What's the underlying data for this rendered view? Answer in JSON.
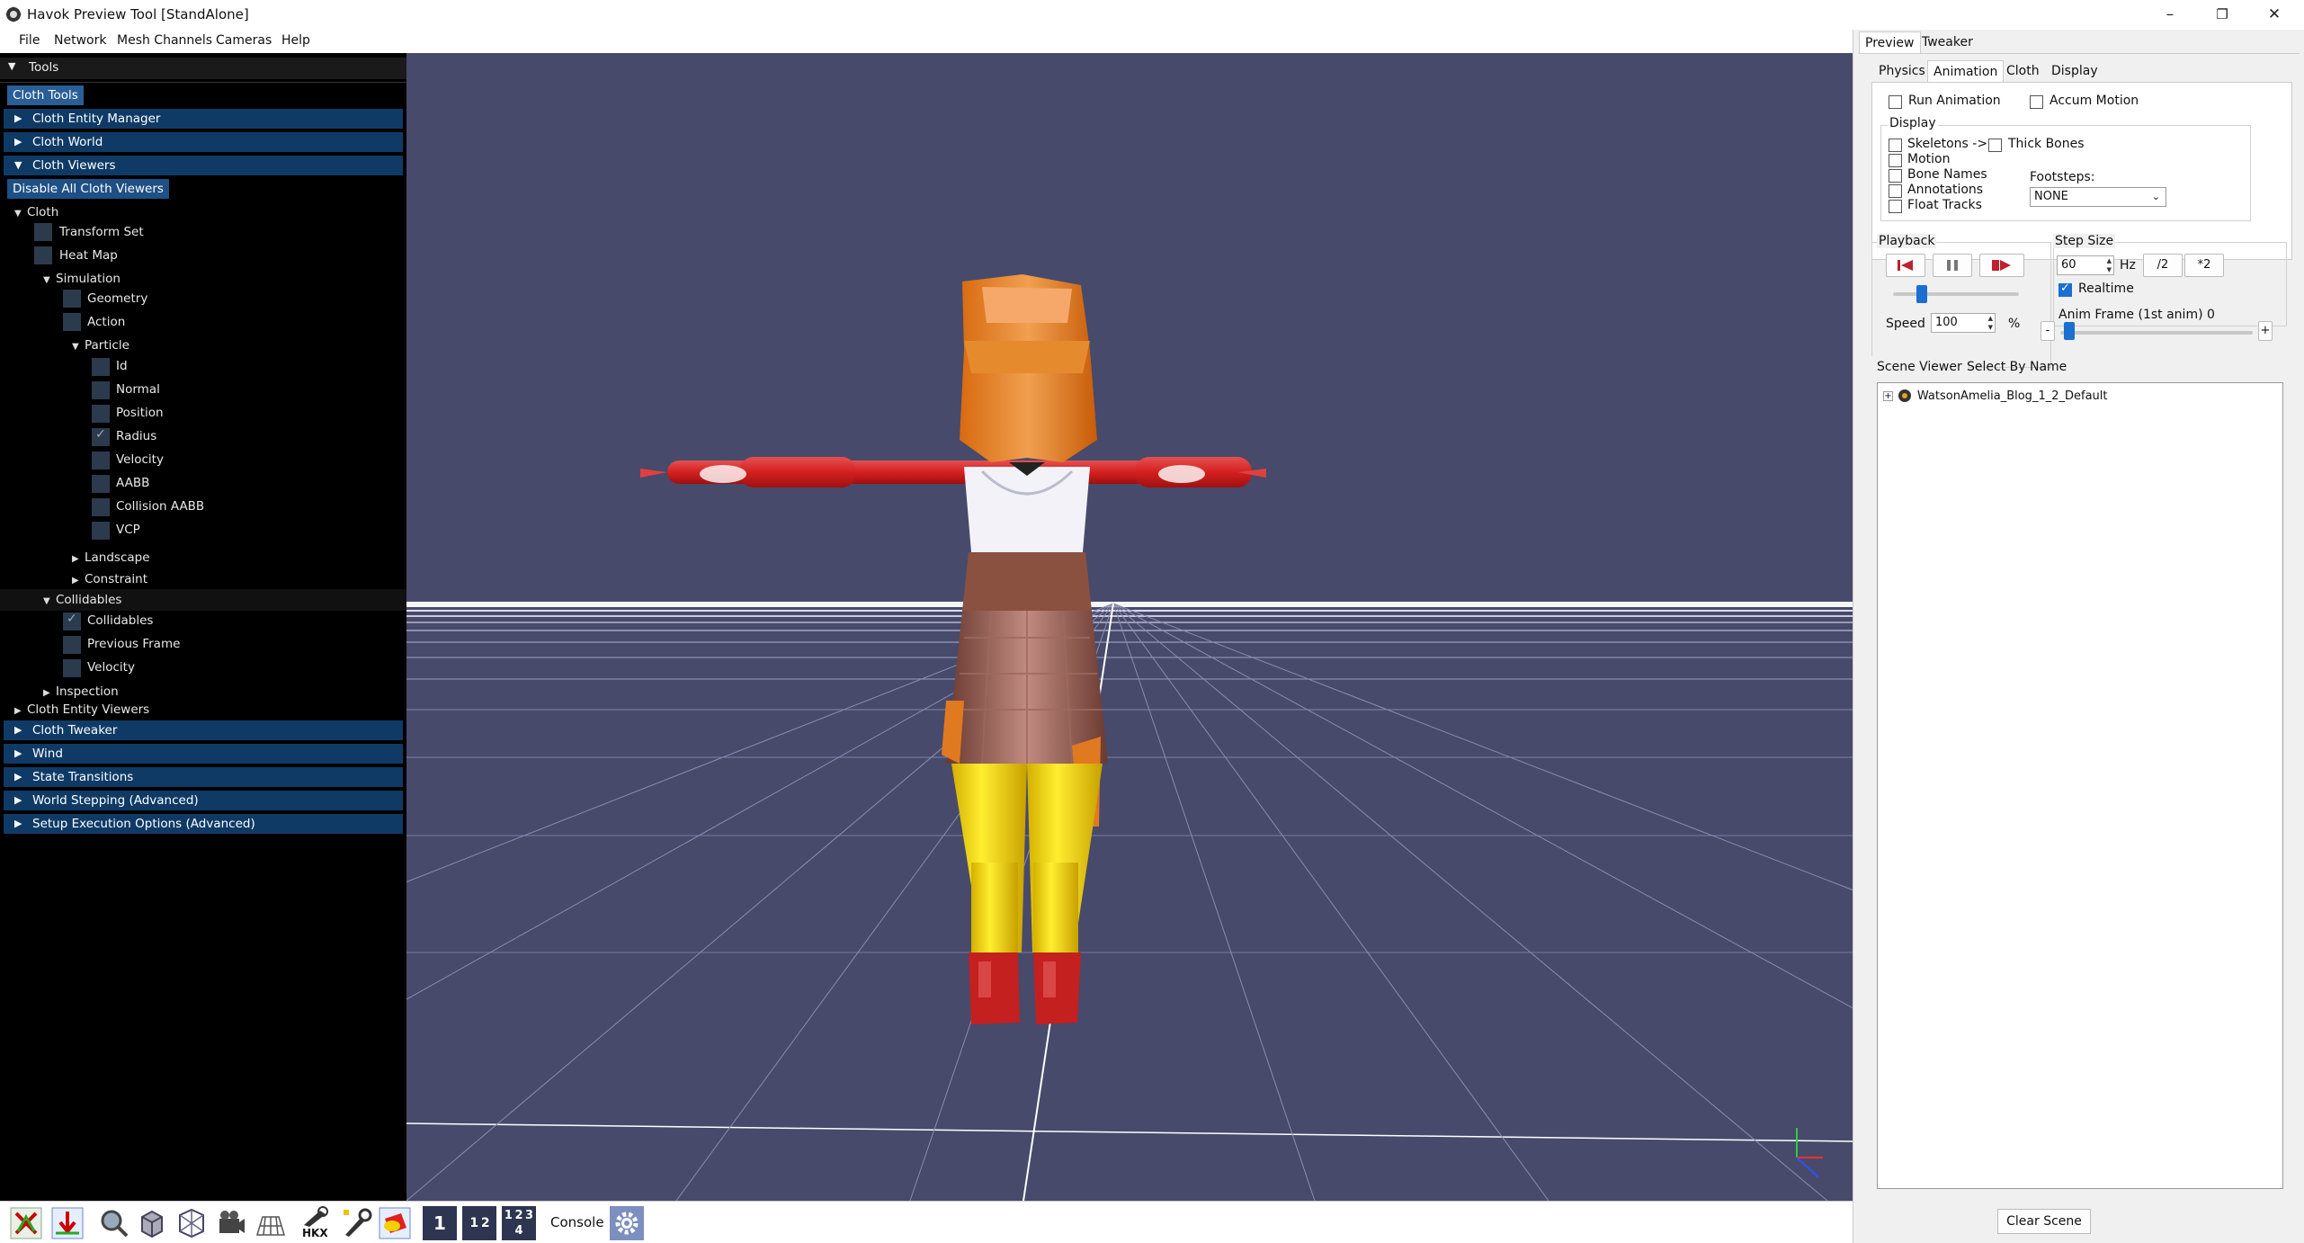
{
  "window": {
    "title": "Havok Preview Tool [StandAlone]",
    "minimize": "–",
    "maximize": "❐",
    "close": "✕"
  },
  "menu": {
    "items": [
      "File",
      "Network",
      "Mesh Channels",
      "Cameras",
      "Help"
    ]
  },
  "tools": {
    "header": "Tools",
    "cloth_tools_button": "Cloth Tools",
    "sections_top": [
      "Cloth Entity Manager",
      "Cloth World",
      "Cloth Viewers"
    ],
    "disable_all_button": "Disable All Cloth Viewers",
    "tree": {
      "cloth": "Cloth",
      "transform_set": "Transform Set",
      "heat_map": "Heat Map",
      "simulation": "Simulation",
      "geometry": "Geometry",
      "action": "Action",
      "particle": "Particle",
      "particle_items": [
        "Id",
        "Normal",
        "Position",
        "Radius",
        "Velocity",
        "AABB",
        "Collision AABB",
        "VCP"
      ],
      "particle_checked": [
        false,
        false,
        false,
        true,
        false,
        false,
        false,
        false
      ],
      "landscape": "Landscape",
      "constraint": "Constraint",
      "collidables_group": "Collidables",
      "collidables_items": [
        "Collidables",
        "Previous Frame",
        "Velocity"
      ],
      "collidables_checked": [
        true,
        false,
        false
      ],
      "inspection": "Inspection",
      "cloth_entity_viewers": "Cloth Entity Viewers"
    },
    "sections_bottom": [
      "Cloth Tweaker",
      "Wind",
      "State Transitions",
      "World Stepping (Advanced)",
      "Setup Execution Options (Advanced)"
    ]
  },
  "bottom_toolbar": {
    "icons": [
      "tool-cross-icon",
      "arrow-down-icon",
      "magnifier-icon",
      "cube-icon",
      "box-select-icon",
      "camera-icon",
      "grid-icon",
      "hkx-file-icon",
      "wrench-icon",
      "record-icon"
    ],
    "hkx_label": "HKX",
    "layout_1": "1",
    "layout_2": "1 2",
    "layout_4": "1 2 3 4",
    "console": "Console",
    "settings_icon": "gear-icon"
  },
  "right": {
    "top_tabs": [
      "Preview",
      "Tweaker"
    ],
    "sub_tabs": [
      "Physics",
      "Animation",
      "Cloth",
      "Display"
    ],
    "active_sub_tab": "Animation",
    "run_animation": "Run Animation",
    "accum_motion": "Accum Motion",
    "display_group": "Display",
    "skeletons": "Skeletons ->",
    "thick_bones": "Thick Bones",
    "motion": "Motion",
    "bone_names": "Bone Names",
    "annotations": "Annotations",
    "float_tracks": "Float Tracks",
    "footsteps_label": "Footsteps:",
    "footsteps_value": "NONE",
    "playback_group": "Playback",
    "speed_label": "Speed",
    "speed_value": "100",
    "speed_unit": "%",
    "stepsize_group": "Step Size",
    "step_value": "60",
    "step_unit": "Hz",
    "half_button": "/2",
    "double_button": "*2",
    "realtime": "Realtime",
    "realtime_checked": true,
    "anim_frame_label": "Anim Frame (1st anim) 0",
    "minus": "-",
    "plus": "+",
    "scene_tabs": [
      "Scene Viewer",
      "Select By Name"
    ],
    "scene_root": "WatsonAmelia_Blog_1_2_Default",
    "clear_scene": "Clear Scene"
  },
  "colors": {
    "viewport_bg": "#474a6b",
    "panel_header": "#0f3a66",
    "button_blue": "#2a5e97",
    "accent": "#1a6fd0"
  }
}
